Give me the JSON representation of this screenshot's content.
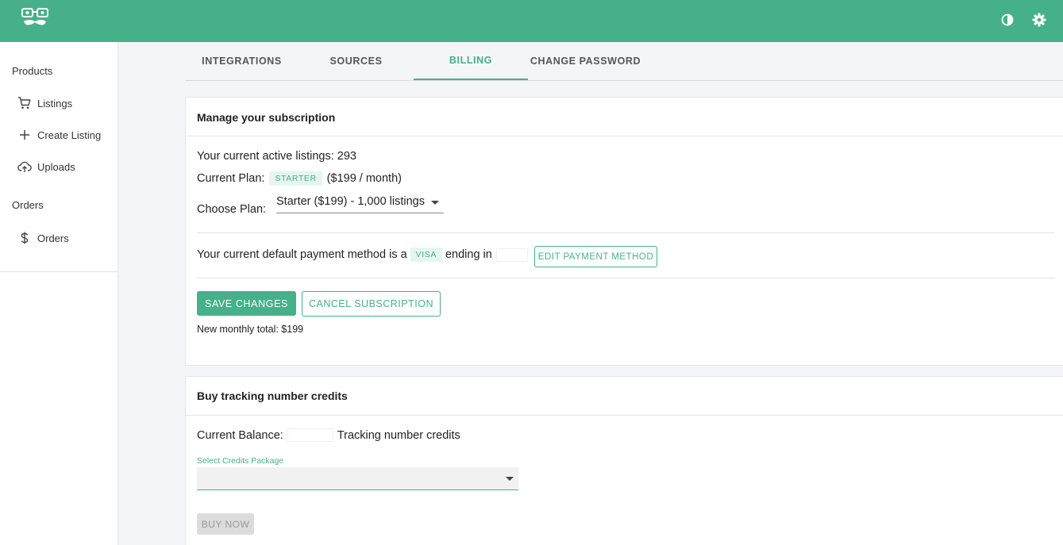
{
  "header": {
    "logo_icon": "mustache-glasses-logo",
    "theme_toggle_icon": "contrast-icon",
    "settings_icon": "gear-icon",
    "brand_color": "#46b08b"
  },
  "sidebar": {
    "groups": [
      {
        "label": "Products",
        "items": [
          {
            "label": "Listings",
            "icon": "cart-icon"
          },
          {
            "label": "Create Listing",
            "icon": "plus-icon"
          },
          {
            "label": "Uploads",
            "icon": "cloud-upload-icon"
          }
        ]
      },
      {
        "label": "Orders",
        "items": [
          {
            "label": "Orders",
            "icon": "dollar-icon"
          }
        ]
      }
    ]
  },
  "tabs": [
    {
      "label": "INTEGRATIONS",
      "active": false
    },
    {
      "label": "SOURCES",
      "active": false
    },
    {
      "label": "BILLING",
      "active": true
    },
    {
      "label": "CHANGE PASSWORD",
      "active": false
    }
  ],
  "subscription": {
    "title": "Manage your subscription",
    "active_listings_text": "Your current active listings: 293",
    "current_plan_label": "Current Plan:",
    "current_plan_chip": "STARTER",
    "current_plan_price": "($199 / month)",
    "choose_plan_label": "Choose Plan:",
    "choose_plan_value": "Starter ($199) - 1,000 listings",
    "payment_text_prefix": "Your current default payment method is a",
    "payment_card_chip": "VISA",
    "payment_text_suffix": "ending in",
    "edit_payment_label": "EDIT PAYMENT METHOD",
    "save_label": "SAVE CHANGES",
    "cancel_label": "CANCEL SUBSCRIPTION",
    "new_total_text": "New monthly total: $199"
  },
  "credits": {
    "title": "Buy tracking number credits",
    "balance_label": "Current Balance:",
    "balance_suffix": "Tracking number credits",
    "select_label": "Select Credits Package",
    "select_value": "",
    "buy_label": "BUY NOW"
  }
}
